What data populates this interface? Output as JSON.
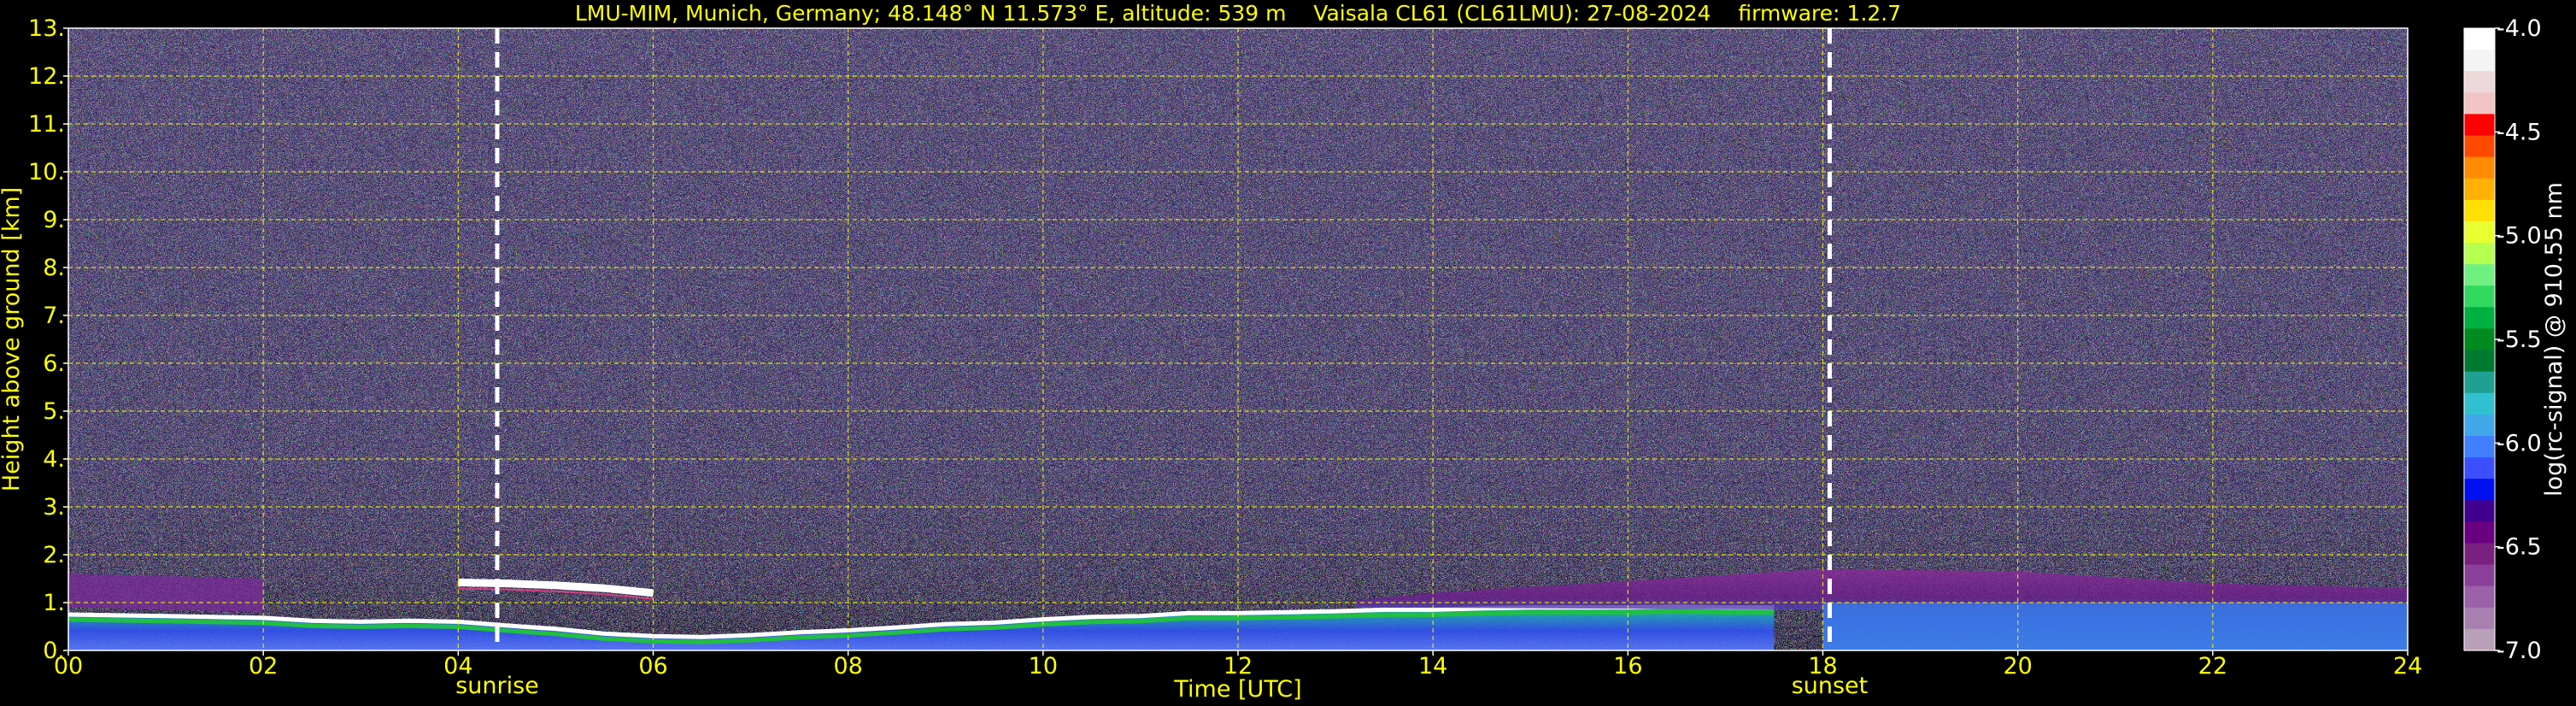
{
  "chart_data": {
    "type": "heatmap",
    "title": "LMU-MIM, Munich, Germany; 48.148° N 11.573° E, altitude: 539 m    Vaisala CL61 (CL61LMU): 27-08-2024    firmware: 1.2.7",
    "xlabel": "Time [UTC]",
    "ylabel": "Height above ground [km]",
    "xlim": [
      0,
      24
    ],
    "ylim": [
      0,
      13
    ],
    "x_ticks": [
      "00",
      "02",
      "04",
      "06",
      "08",
      "10",
      "12",
      "14",
      "16",
      "18",
      "20",
      "22",
      "24"
    ],
    "y_ticks": [
      "0.",
      "1.",
      "2.",
      "3.",
      "4.",
      "5.",
      "6.",
      "7.",
      "8.",
      "9.",
      "10.",
      "11.",
      "12.",
      "13."
    ],
    "grid": true,
    "events": [
      {
        "label": "sunrise",
        "time": 4.4
      },
      {
        "label": "sunset",
        "time": 18.07
      }
    ],
    "colorbar": {
      "label": "log(rc-signal) @ 910.55 nm",
      "range": [
        -7.0,
        -4.0
      ],
      "ticks": [
        "-4.0",
        "-4.5",
        "-5.0",
        "-5.5",
        "-6.0",
        "-6.5",
        "-7.0"
      ],
      "colors": [
        "#ffffff",
        "#f4f4f4",
        "#ecd8d8",
        "#f2c4c4",
        "#ff0000",
        "#ff4a00",
        "#ff8c00",
        "#ffb000",
        "#ffe000",
        "#e8ff30",
        "#b4ff50",
        "#70f080",
        "#30d860",
        "#00b040",
        "#008a20",
        "#007a30",
        "#20a090",
        "#30c0d0",
        "#40a8e8",
        "#4080ff",
        "#3a50ff",
        "#0010f0",
        "#400090",
        "#6a0080",
        "#7a2080",
        "#8a4098",
        "#9a60a8",
        "#a880b0",
        "#b8a0b8"
      ]
    },
    "features": [
      {
        "name": "boundary layer top",
        "times": [
          0,
          1,
          2,
          2.5,
          3,
          3.5,
          4,
          4.5,
          5,
          5.5,
          6,
          6.5,
          7,
          7.5,
          8,
          8.5,
          9,
          9.5,
          10,
          10.5,
          11,
          11.5,
          12,
          12.5,
          13,
          13.5,
          14,
          14.5,
          15,
          15.5,
          16,
          16.5,
          17,
          17.5
        ],
        "heights": [
          0.75,
          0.72,
          0.68,
          0.62,
          0.6,
          0.62,
          0.6,
          0.52,
          0.45,
          0.35,
          0.3,
          0.28,
          0.32,
          0.38,
          0.42,
          0.48,
          0.55,
          0.58,
          0.65,
          0.7,
          0.72,
          0.78,
          0.78,
          0.8,
          0.82,
          0.85,
          0.85,
          0.88,
          0.9,
          0.9,
          0.9,
          0.92,
          0.9,
          0.9
        ]
      },
      {
        "name": "elevated layer",
        "times": [
          4,
          4.5,
          5,
          5.5,
          6
        ],
        "heights": [
          1.42,
          1.4,
          1.36,
          1.3,
          1.2
        ]
      }
    ]
  }
}
